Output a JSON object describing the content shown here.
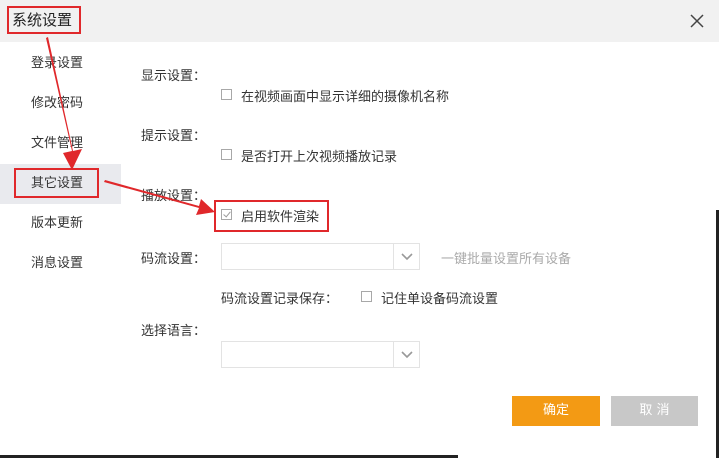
{
  "dialog": {
    "title": "系统设置"
  },
  "sidebar": {
    "items": [
      {
        "label": "登录设置"
      },
      {
        "label": "修改密码"
      },
      {
        "label": "文件管理"
      },
      {
        "label": "其它设置"
      },
      {
        "label": "版本更新"
      },
      {
        "label": "消息设置"
      }
    ],
    "active_index": 3
  },
  "display": {
    "label": "显示设置：",
    "option": "在视频画面中显示详细的摄像机名称",
    "checked": false
  },
  "prompt": {
    "label": "提示设置：",
    "option": "是否打开上次视频播放记录",
    "checked": false
  },
  "playback": {
    "label": "播放设置：",
    "option": "启用软件渲染",
    "checked": true
  },
  "stream": {
    "label": "码流设置：",
    "selected": "",
    "hint": "一键批量设置所有设备",
    "save_label": "码流设置记录保存：",
    "save_option": "记住单设备码流设置",
    "save_checked": false
  },
  "language": {
    "label": "选择语言：",
    "selected": ""
  },
  "buttons": {
    "ok": "确定",
    "cancel": "取 消"
  },
  "colors": {
    "accent": "#f39a14",
    "annotation": "#e0282b",
    "active_bg": "#e9eaee"
  },
  "icons": {
    "close": "close-icon",
    "dropdown": "chevron-down-icon"
  }
}
